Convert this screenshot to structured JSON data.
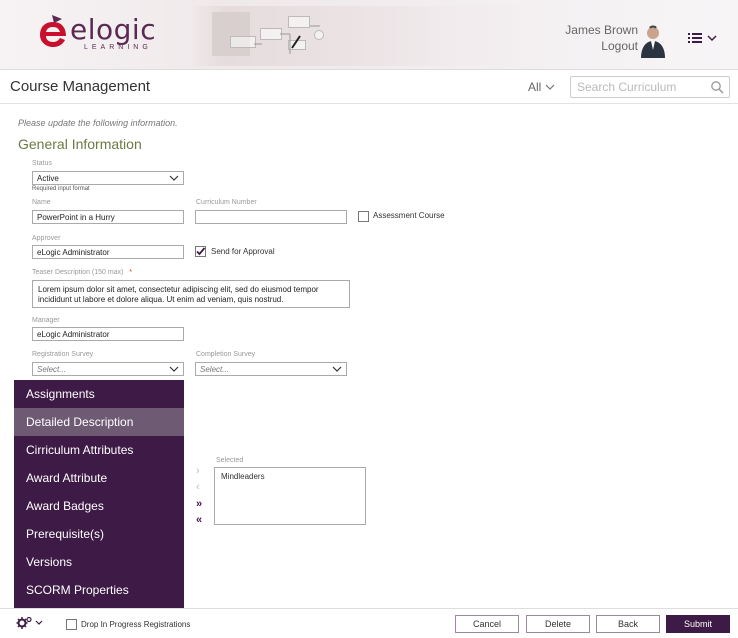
{
  "header": {
    "logo_word": "elogic",
    "logo_sub": "LEARNING",
    "user_name": "James Brown",
    "logout_label": "Logout"
  },
  "titlebar": {
    "title": "Course Management",
    "scope_value": "All",
    "search_placeholder": "Search Curriculum"
  },
  "form": {
    "instructions": "Please update the following information.",
    "section_title": "General Information",
    "status": {
      "label": "Status",
      "value": "Active",
      "hint": "Required input format"
    },
    "name": {
      "label": "Name",
      "value": "PowerPoint in a Hurry"
    },
    "curriculum_number": {
      "label": "Curriculum Number",
      "value": ""
    },
    "assessment_course": {
      "label": "Assessment Course",
      "checked": false
    },
    "approver": {
      "label": "Approver",
      "value": "eLogic Administrator"
    },
    "send_for_approval": {
      "label": "Send for Approval",
      "checked": true
    },
    "teaser": {
      "label": "Teaser Description (150 max)",
      "required_mark": "*",
      "value": "Lorem ipsum dolor sit amet, consectetur adipiscing elit, sed do eiusmod tempor incididunt ut labore et dolore aliqua. Ut enim ad veniam, quis nostrud."
    },
    "manager": {
      "label": "Manager",
      "value": "eLogic Administrator"
    },
    "registration_survey": {
      "label": "Registration Survey",
      "placeholder": "Select..."
    },
    "completion_survey": {
      "label": "Completion Survey",
      "placeholder": "Select..."
    },
    "selected": {
      "label": "Selected",
      "items": [
        "Mindleaders"
      ]
    }
  },
  "side_menu": {
    "items": [
      "Assignments",
      "Detailed Description",
      "Cirriculum Attributes",
      "Award Attribute",
      "Award Badges",
      "Prerequisite(s)",
      "Versions",
      "SCORM Properties"
    ],
    "active_index": 1
  },
  "footer": {
    "drop_in_progress": {
      "label": "Drop In Progress Registrations",
      "checked": false
    },
    "buttons": {
      "cancel": "Cancel",
      "delete": "Delete",
      "back": "Back",
      "submit": "Submit"
    }
  },
  "colors": {
    "brand_purple": "#3e1a46",
    "section_green": "#6c7a43",
    "logo_red": "#c8102e"
  }
}
